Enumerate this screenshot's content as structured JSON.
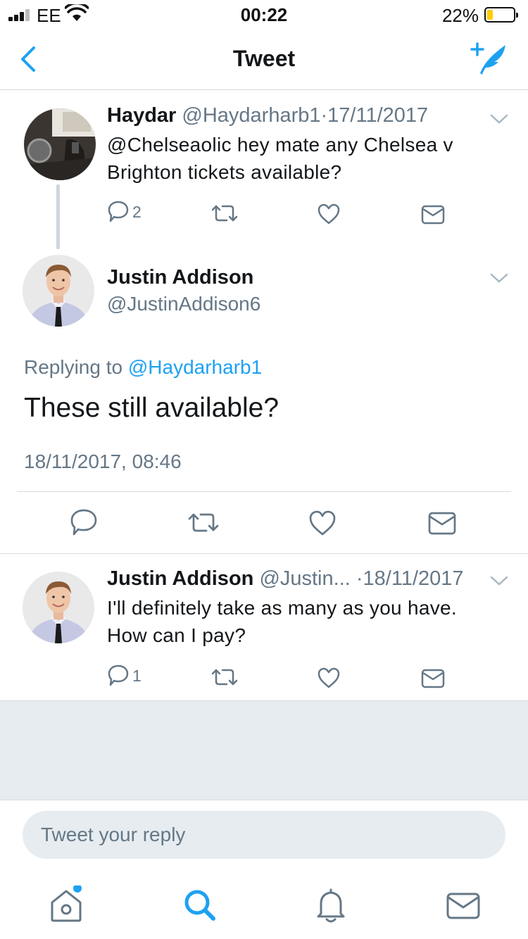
{
  "status_bar": {
    "carrier": "EE",
    "time": "00:22",
    "battery_percent": "22%",
    "battery_level": 0.22
  },
  "nav": {
    "title": "Tweet",
    "back_icon": "chevron-left-icon",
    "compose_icon": "compose-tweet-icon"
  },
  "parent_tweet": {
    "name": "Haydar",
    "handle": "@Haydarharb1",
    "separator": "·",
    "date": "17/11/2017",
    "text_line1": "@Chelseaolic hey mate any Chelsea v",
    "text_line2": "Brighton tickets available?",
    "reply_count": "2"
  },
  "focused_tweet": {
    "name": "Justin Addison",
    "handle": "@JustinAddison6",
    "replying_prefix": "Replying to",
    "replying_to": "@Haydarharb1",
    "text": "These still available?",
    "timestamp": "18/11/2017, 08:46"
  },
  "reply_tweet": {
    "name": "Justin Addison",
    "handle": "@Justin...",
    "separator": "·",
    "date": "18/11/2017",
    "text_line1": "I'll definitely take as many as you have.",
    "text_line2": "How can I pay?",
    "reply_count": "1"
  },
  "reply_box": {
    "placeholder": "Tweet your reply"
  },
  "tab_bar": {
    "items": [
      "home-icon",
      "search-icon",
      "notifications-icon",
      "messages-icon"
    ]
  },
  "colors": {
    "accent": "#1da1f2",
    "secondary_text": "#657786",
    "background_gray": "#e6ecf0"
  }
}
